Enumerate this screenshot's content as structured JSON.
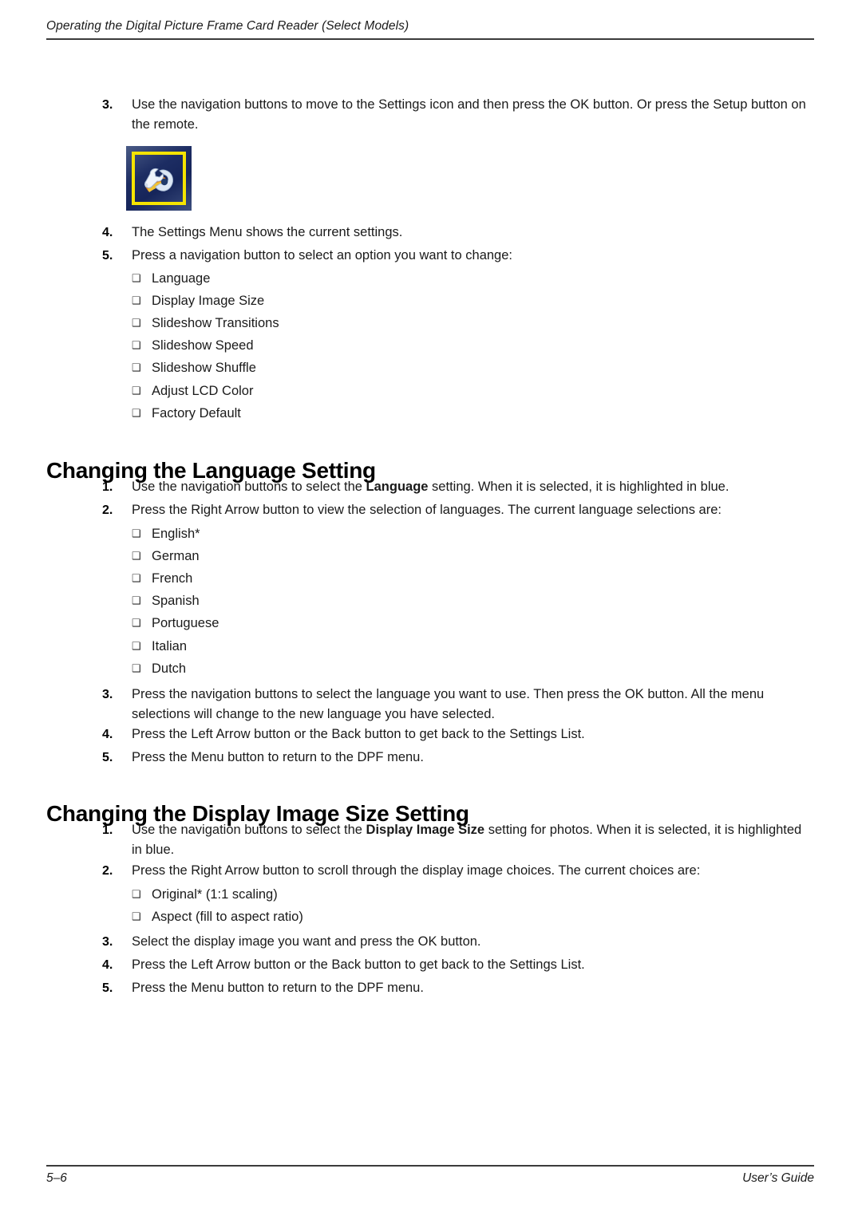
{
  "header": {
    "running_title": "Operating the Digital Picture Frame Card Reader (Select Models)"
  },
  "footer": {
    "page_number": "5–6",
    "guide_label": "User’s Guide"
  },
  "icons": {
    "bullet_glyph": "❑",
    "settings_figure_name": "settings-wrench-icon"
  },
  "colors": {
    "icon_frame": "#f5e400",
    "icon_background_dark": "#16255a",
    "icon_background_light": "#4a5b86",
    "rule": "#3b3b3b",
    "text": "#1a1a1a"
  },
  "intro_steps": [
    {
      "number": "3.",
      "text_before": "Use the navigation buttons to move to the Settings icon and then press the OK button. Or press the Setup button on the remote.",
      "bold": "",
      "text_after": ""
    },
    {
      "number": "4.",
      "text_before": "The Settings Menu shows the current settings.",
      "bold": "",
      "text_after": ""
    },
    {
      "number": "5.",
      "text_before": "Press a navigation button to select an option you want to change:",
      "bold": "",
      "text_after": ""
    }
  ],
  "settings_options": [
    "Language",
    "Display Image Size",
    "Slideshow Transitions",
    "Slideshow Speed",
    "Slideshow Shuffle",
    "Adjust LCD Color",
    "Factory Default"
  ],
  "language_section": {
    "heading": "Changing the Language Setting",
    "steps_top": [
      {
        "number": "1.",
        "text_before": "Use the navigation buttons to select the ",
        "bold": "Language",
        "text_after": " setting. When it is selected, it is highlighted in blue."
      },
      {
        "number": "2.",
        "text_before": "Press the Right Arrow button to view the selection of languages. The current language selections are:",
        "bold": "",
        "text_after": ""
      }
    ],
    "languages": [
      "English*",
      "German",
      "French",
      "Spanish",
      "Portuguese",
      "Italian",
      "Dutch"
    ],
    "steps_bottom": [
      {
        "number": "3.",
        "text_before": "Press the navigation buttons to select the language you want to use. Then press the OK button. All the menu selections will change to the new language you have selected.",
        "bold": "",
        "text_after": ""
      },
      {
        "number": "4.",
        "text_before": "Press the Left Arrow button or the Back button to get back to the Settings List.",
        "bold": "",
        "text_after": ""
      },
      {
        "number": "5.",
        "text_before": "Press the Menu button to return to the DPF menu.",
        "bold": "",
        "text_after": ""
      }
    ]
  },
  "display_size_section": {
    "heading": "Changing the Display Image Size Setting",
    "steps_top": [
      {
        "number": "1.",
        "text_before": "Use the navigation buttons to select the ",
        "bold": "Display Image Size",
        "text_after": " setting for photos. When it is selected, it is highlighted in blue."
      },
      {
        "number": "2.",
        "text_before": "Press the Right Arrow button to scroll through the display image choices. The current choices are:",
        "bold": "",
        "text_after": ""
      }
    ],
    "choices": [
      "Original* (1:1 scaling)",
      "Aspect (fill to aspect ratio)"
    ],
    "steps_bottom": [
      {
        "number": "3.",
        "text_before": "Select the display image you want and press the OK button.",
        "bold": "",
        "text_after": ""
      },
      {
        "number": "4.",
        "text_before": "Press the Left Arrow button or the Back button to get back to the Settings List.",
        "bold": "",
        "text_after": ""
      },
      {
        "number": "5.",
        "text_before": "Press the Menu button to return to the DPF menu.",
        "bold": "",
        "text_after": ""
      }
    ]
  }
}
